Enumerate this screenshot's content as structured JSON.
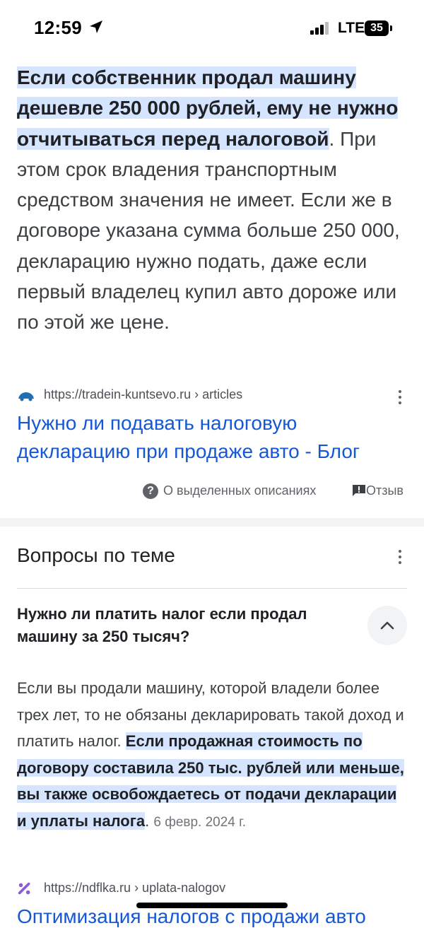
{
  "status_bar": {
    "time": "12:59",
    "network": "LTE",
    "battery": "35"
  },
  "snippet": {
    "highlight": "Если собственник продал машину дешевле 250 000 рублей, ему не нужно отчитываться перед налоговой",
    "rest": ". При этом срок владения транспортным средством значения не имеет. Если же в договоре указана сумма больше 250 000, декларацию нужно подать, даже если первый владелец купил авто дороже или по этой же цене."
  },
  "result": {
    "url": "https://tradein-kuntsevo.ru › articles",
    "title": "Нужно ли подавать налоговую декларацию при продаже авто - Блог"
  },
  "footer": {
    "about": "О выделенных описаниях",
    "feedback": "Отзыв"
  },
  "related": {
    "title": "Вопросы по теме",
    "question": "Нужно ли платить налог если продал машину за 250 тысяч?",
    "answer_plain": "Если вы продали машину, которой владели более трех лет, то не обязаны декларировать такой доход и платить налог. ",
    "answer_highlight": "Если продажная стоимость по договору составила 250 тыс. рублей или меньше, вы также освобождаетесь от подачи декларации и уплаты налога",
    "answer_end": ".",
    "date": "6 февр. 2024 г.",
    "source_url": "https://ndflka.ru › uplata-nalogov",
    "source_title_partial": "Оптимизация налогов с продажи авто"
  }
}
